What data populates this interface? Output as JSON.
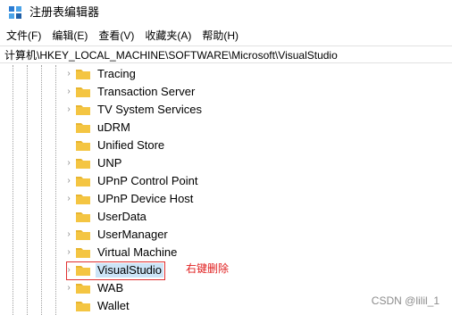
{
  "window": {
    "title": "注册表编辑器"
  },
  "menu": [
    "文件(F)",
    "编辑(E)",
    "查看(V)",
    "收藏夹(A)",
    "帮助(H)"
  ],
  "address": "计算机\\HKEY_LOCAL_MACHINE\\SOFTWARE\\Microsoft\\VisualStudio",
  "tree": {
    "items": [
      {
        "label": "Tracing",
        "expandable": true
      },
      {
        "label": "Transaction Server",
        "expandable": true
      },
      {
        "label": "TV System Services",
        "expandable": true
      },
      {
        "label": "uDRM",
        "expandable": false
      },
      {
        "label": "Unified Store",
        "expandable": false
      },
      {
        "label": "UNP",
        "expandable": true
      },
      {
        "label": "UPnP Control Point",
        "expandable": true
      },
      {
        "label": "UPnP Device Host",
        "expandable": true
      },
      {
        "label": "UserData",
        "expandable": false
      },
      {
        "label": "UserManager",
        "expandable": true
      },
      {
        "label": "Virtual Machine",
        "expandable": true
      },
      {
        "label": "VisualStudio",
        "expandable": true,
        "selected": true
      },
      {
        "label": "WAB",
        "expandable": true
      },
      {
        "label": "Wallet",
        "expandable": false
      }
    ]
  },
  "annotation": "右键删除",
  "watermark": "CSDN @lilil_1",
  "colors": {
    "selection": "#cce4f7",
    "annotation": "#e02020",
    "folder": "#f4c542"
  }
}
